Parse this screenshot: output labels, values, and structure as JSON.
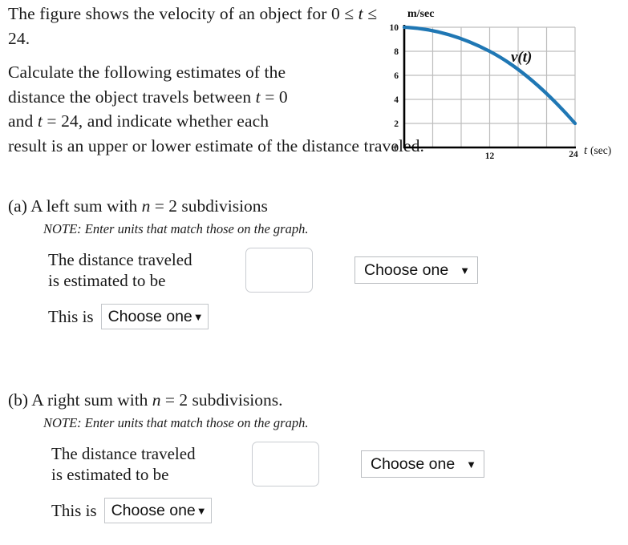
{
  "intro": {
    "line1": "The figure shows the velocity of an object",
    "line2_prefix": "for 0 ",
    "line2_le1": "≤",
    "line2_t": "t",
    "line2_le2": "≤",
    "line2_end": "24.",
    "para2_line1": "Calculate the following estimates of the",
    "para2_line2a": "distance the object travels between ",
    "para2_line2_t": "t",
    "para2_line2_eq": " = 0",
    "para2_line3a": "and ",
    "para2_line3_t": "t",
    "para2_line3_eq": " = 24,",
    "para2_line3b": " and indicate whether each",
    "para2_line4": "result is an upper or lower estimate of the distance traveled."
  },
  "figure": {
    "ylabel": "m/sec",
    "xlabel_t": "t",
    "xlabel_unit": "(sec)",
    "curve_label_v": "v",
    "curve_label_paren_open": "(",
    "curve_label_t": "t",
    "curve_label_paren_close": ")",
    "curve_color": "#1f77b4",
    "grid_color": "#bdbdbd",
    "axis_color": "#000000"
  },
  "chart_data": {
    "type": "line",
    "title": "",
    "xlabel": "t (sec)",
    "ylabel": "m/sec",
    "xlim": [
      0,
      24
    ],
    "ylim": [
      0,
      10
    ],
    "xticks": [
      0,
      12,
      24
    ],
    "yticks": [
      0,
      2,
      4,
      6,
      8,
      10
    ],
    "xtick_labels": [
      "0",
      "12",
      "24"
    ],
    "ytick_labels": [
      "0",
      "2",
      "4",
      "6",
      "8",
      "10"
    ],
    "x_gridlines": [
      4,
      8,
      12,
      16,
      20,
      24
    ],
    "y_gridlines": [
      2,
      4,
      6,
      8,
      10
    ],
    "grid": true,
    "legend": false,
    "annotations": [
      {
        "text": "v(t)",
        "x": 15.5,
        "y": 8.6
      }
    ],
    "series": [
      {
        "name": "v(t)",
        "color": "#1f77b4",
        "x": [
          0,
          2,
          4,
          6,
          8,
          10,
          12,
          14,
          16,
          18,
          20,
          22,
          24
        ],
        "y": [
          10.0,
          9.95,
          9.85,
          9.6,
          9.25,
          8.75,
          8.15,
          7.45,
          6.6,
          5.65,
          4.6,
          3.4,
          2.0
        ]
      }
    ]
  },
  "parts": [
    {
      "label": "(a)",
      "heading_a": "A left sum with ",
      "heading_n": "n",
      "heading_b": " = 2 subdivisions",
      "note": "NOTE: Enter units that match those on the graph.",
      "answer_line1": "The distance traveled",
      "answer_line2": "is estimated to be",
      "input_value": "",
      "input_placeholder": "",
      "units_select": "Choose one",
      "thisis_text": "This is",
      "estimate_select": "Choose one",
      "caret": "▼"
    },
    {
      "label": "(b)",
      "heading_a": "A right sum with ",
      "heading_n": "n",
      "heading_b": " = 2 subdivisions.",
      "note": "NOTE: Enter units that match those on the graph.",
      "answer_line1": "The distance traveled",
      "answer_line2": "is estimated to be",
      "input_value": "",
      "input_placeholder": "",
      "units_select": "Choose one",
      "thisis_text": "This is",
      "estimate_select": "Choose one",
      "caret": "▼"
    }
  ]
}
